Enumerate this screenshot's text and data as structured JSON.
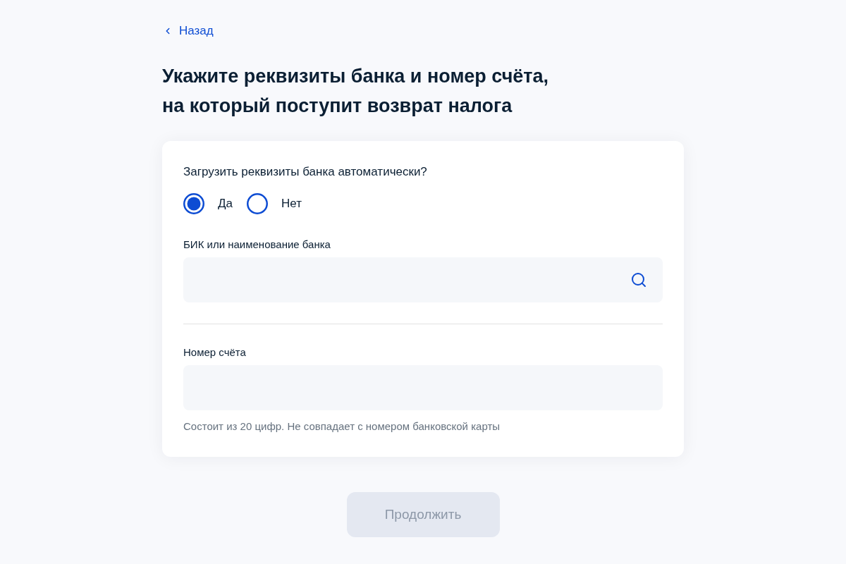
{
  "back_link": {
    "label": "Назад"
  },
  "title_lines": [
    "Укажите реквизиты банка и номер счёта,",
    "на который поступит возврат налога"
  ],
  "form": {
    "question": "Загрузить реквизиты банка автоматически?",
    "options": [
      {
        "label": "Да",
        "selected": true
      },
      {
        "label": "Нет",
        "selected": false
      }
    ],
    "fields": [
      {
        "kind": "search",
        "label": "БИК или наименование банка"
      },
      {
        "kind": "text",
        "label": "Номер счёта",
        "hint": "Состоит из 20 цифр. Не совпадает с номером банковской карты"
      }
    ]
  },
  "continue_button": {
    "label": "Продолжить",
    "disabled": true
  }
}
